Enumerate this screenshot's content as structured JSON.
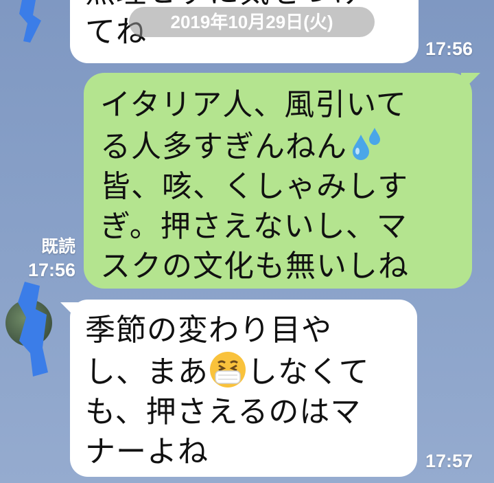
{
  "date_separator": "2019年10月29日(火)",
  "messages": [
    {
      "lines": [
        "無理せずに気をつけ",
        "てね"
      ],
      "time": "17:56"
    },
    {
      "lines": [
        "イタリア人、風引いて",
        "る人多すぎんねん",
        "皆、咳、くしゃみしす",
        "ぎ。押さえないし、マ",
        "スクの文化も無いしね"
      ],
      "read_status": "既読",
      "time": "17:56",
      "emoji": "sweat-drops"
    },
    {
      "line1": "季節の変わり目や",
      "line2a": "し、まあ",
      "line2b": "しなくて",
      "line3": "も、押さえるのはマ",
      "line4": "ナーよね",
      "time": "17:57",
      "emoji": "mask-face"
    }
  ]
}
